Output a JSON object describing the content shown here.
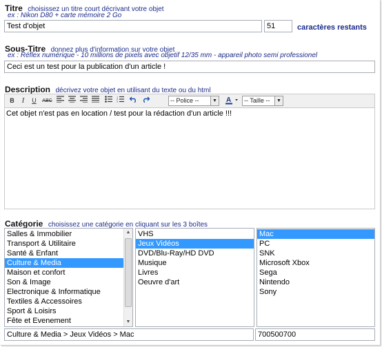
{
  "titre": {
    "label": "Titre",
    "hint": "choisissez un titre court décrivant votre objet",
    "example": "ex : Nikon D80 + carte mémoire 2 Go",
    "value": "Test d'objet",
    "counter": "51",
    "counter_label": "caractères restants"
  },
  "sous_titre": {
    "label": "Sous-Titre",
    "hint": "donnez plus d'information sur votre objet",
    "example": "ex : Réflex numérique - 10 millions de pixels avec objetif 12/35 mm - appareil photo semi professionel",
    "value": "Ceci est un test pour la publication d'un article !"
  },
  "description": {
    "label": "Description",
    "hint": "décrivez votre objet en utilisant du texte ou du html",
    "toolbar": {
      "font_select": "-- Police --",
      "size_select": "-- Taille --"
    },
    "content": "Cet objet n'est pas en location / test pour la rédaction d'un article !!!"
  },
  "categorie": {
    "label": "Catégorie",
    "hint": "choisissez une catégorie en cliquant sur les 3 boîtes",
    "list1": [
      "Salles & Immobilier",
      "Transport & Utilitaire",
      "Santé & Enfant",
      "Culture & Media",
      "Maison et confort",
      "Son & Image",
      "Electronique & Informatique",
      "Textiles & Accessoires",
      "Sport & Loisirs",
      "Fête et Evenement"
    ],
    "list1_selected": 3,
    "list2": [
      "VHS",
      "Jeux Vidéos",
      "DVD/Blu-Ray/HD DVD",
      "Musique",
      "Livres",
      "Oeuvre d'art"
    ],
    "list2_selected": 1,
    "list3": [
      "Mac",
      "PC",
      "SNK",
      "Microsoft Xbox",
      "Sega",
      "Nintendo",
      "Sony"
    ],
    "list3_selected": 0,
    "path": "Culture & Media > Jeux Vidéos > Mac",
    "code": "700500700"
  },
  "colors": {
    "hint": "#1a2a8a",
    "selection": "#3399ff"
  }
}
